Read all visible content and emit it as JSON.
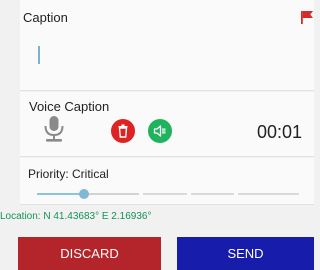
{
  "caption": {
    "label": "Caption",
    "value": "",
    "placeholder": "",
    "flag_icon": "flag-icon",
    "flag_color": "#d62c27"
  },
  "voice": {
    "label": "Voice Caption",
    "mic_icon": "microphone-icon",
    "delete_icon": "trash-icon",
    "play_icon": "speaker-icon",
    "timer": "00:01",
    "delete_color": "#dd2323",
    "play_color": "#1fb35e"
  },
  "priority": {
    "label": "Priority: Critical",
    "level": 0.18
  },
  "location": {
    "text": "Location: N 41.43683° E 2.16936°",
    "color": "#119455"
  },
  "actions": {
    "discard_label": "DISCARD",
    "send_label": "SEND",
    "discard_color": "#b3252a",
    "send_color": "#171caa"
  }
}
